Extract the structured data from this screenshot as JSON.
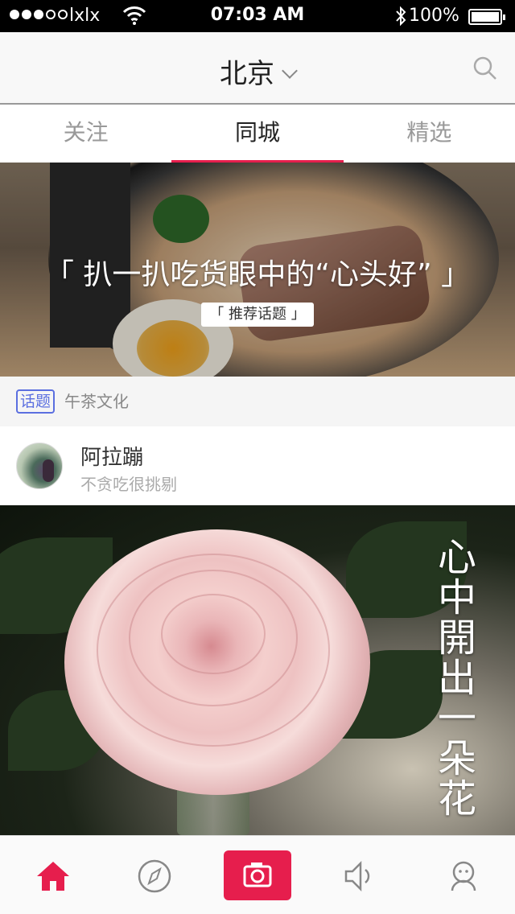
{
  "status_bar": {
    "carrier": "lxlx",
    "time": "07:03 AM",
    "battery": "100%",
    "signal_dots_filled": 3,
    "signal_dots_total": 5
  },
  "nav": {
    "city": "北京"
  },
  "tabs": [
    {
      "label": "关注",
      "active": false
    },
    {
      "label": "同城",
      "active": true
    },
    {
      "label": "精选",
      "active": false
    }
  ],
  "banner": {
    "title": "「 扒一扒吃货眼中的“心头好” 」",
    "tag": "「 推荐话题 」"
  },
  "topic": {
    "badge": "话题",
    "name": "午茶文化"
  },
  "post": {
    "user_name": "阿拉蹦",
    "user_subtitle": "不贪吃很挑剔",
    "caption": [
      "心",
      "中",
      "開",
      "出",
      "一",
      "朵",
      "花"
    ]
  },
  "tab_bar": {
    "items": [
      "home-icon",
      "compass-icon",
      "camera-icon",
      "speaker-icon",
      "profile-icon"
    ],
    "active": "home-icon"
  },
  "colors": {
    "accent": "#e61e4d",
    "topic_badge": "#5b6fe0"
  }
}
